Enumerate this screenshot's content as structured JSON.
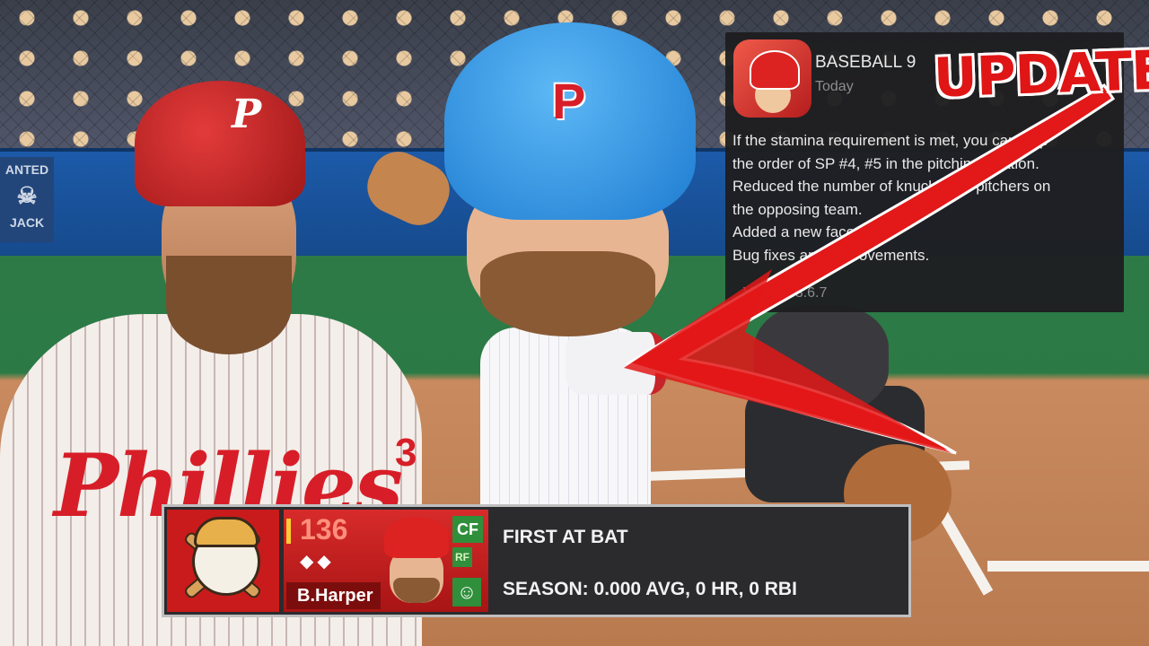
{
  "update_card": {
    "app_name": "BASEBALL 9",
    "date": "Today",
    "notes": [
      "If the stamina requirement is met, you can skip",
      "the order of SP #4, #5 in the pitching rotation.",
      "Reduced the number of knuckleball pitchers on",
      "the opposing team.",
      "Added a new face type.",
      "Bug fixes and improvements."
    ],
    "version": "Version 3.6.7"
  },
  "overlay": {
    "stamp_text": "UPDATE",
    "accent_color": "#e01515"
  },
  "scene": {
    "wall_sign": "ANTED",
    "wall_sign_sub": "JACK",
    "helmet_logo": "P",
    "jersey_text": "Phillies",
    "jersey_number": "3"
  },
  "atbat": {
    "overall": "136",
    "player_name": "B.Harper",
    "position_main": "CF",
    "position_sub": "RF",
    "title": "FIRST AT BAT",
    "season_line": "SEASON: 0.000 AVG, 0 HR, 0 RBI",
    "team_color": "#c91b1b",
    "position_color": "#2f8f3a"
  }
}
